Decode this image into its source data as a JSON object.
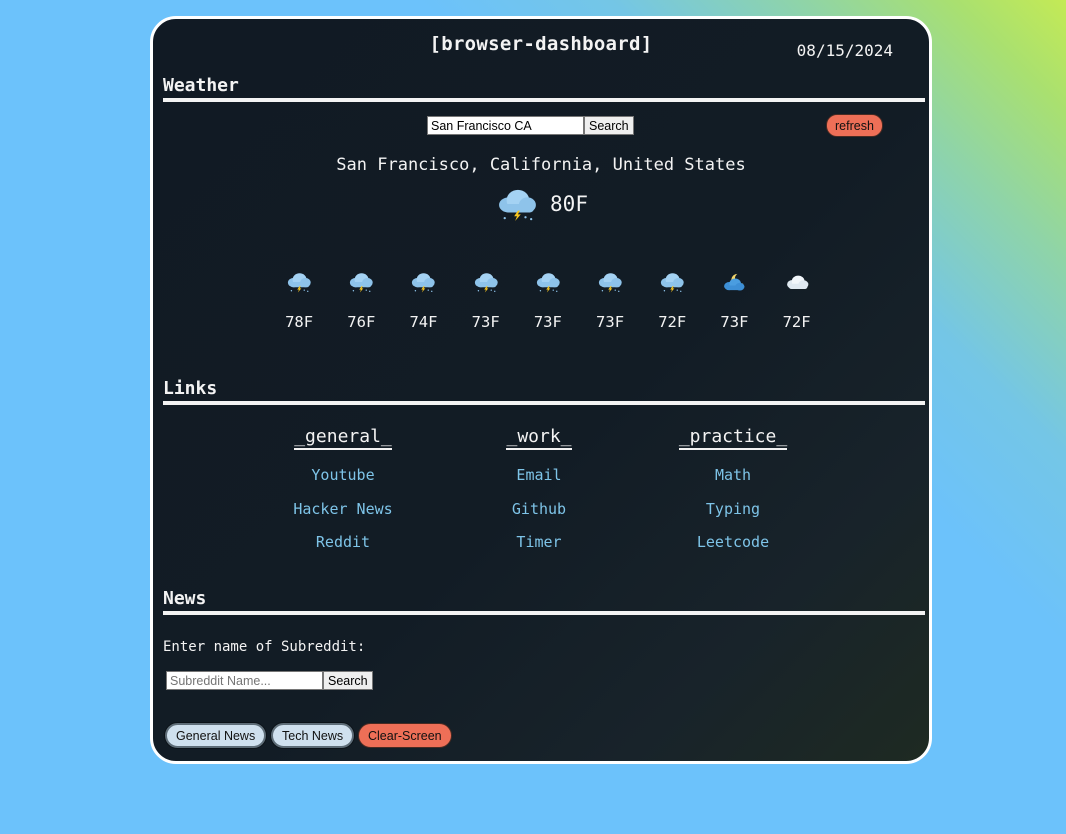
{
  "header": {
    "title": "[browser-dashboard]",
    "date": "08/15/2024"
  },
  "weather": {
    "heading": "Weather",
    "search": {
      "value": "San Francisco CA",
      "button": "Search"
    },
    "refresh_label": "refresh",
    "location": "San Francisco, California, United States",
    "current": {
      "icon": "thunderstorm-icon",
      "temp": "80F"
    },
    "forecast": [
      {
        "icon": "thunderstorm-icon",
        "temp": "78F"
      },
      {
        "icon": "thunderstorm-icon",
        "temp": "76F"
      },
      {
        "icon": "thunderstorm-icon",
        "temp": "74F"
      },
      {
        "icon": "thunderstorm-icon",
        "temp": "73F"
      },
      {
        "icon": "thunderstorm-icon",
        "temp": "73F"
      },
      {
        "icon": "thunderstorm-icon",
        "temp": "73F"
      },
      {
        "icon": "thunderstorm-icon",
        "temp": "72F"
      },
      {
        "icon": "moon-cloud-icon",
        "temp": "73F"
      },
      {
        "icon": "cloud-icon",
        "temp": "72F"
      }
    ]
  },
  "links": {
    "heading": "Links",
    "columns": [
      {
        "title": "_general_",
        "items": [
          "Youtube",
          "Hacker News",
          "Reddit"
        ]
      },
      {
        "title": "_work_",
        "items": [
          "Email",
          "Github",
          "Timer"
        ]
      },
      {
        "title": "_practice_",
        "items": [
          "Math",
          "Typing",
          "Leetcode"
        ]
      }
    ]
  },
  "news": {
    "heading": "News",
    "prompt": "Enter name of Subreddit:",
    "search": {
      "placeholder": "Subreddit Name...",
      "button": "Search"
    },
    "buttons": {
      "general": "General News",
      "tech": "Tech News",
      "clear": "Clear-Screen"
    }
  },
  "colors": {
    "accent_red": "#ee6f57",
    "link_blue": "#7ec4e8",
    "panel_bg": "#111a24"
  }
}
